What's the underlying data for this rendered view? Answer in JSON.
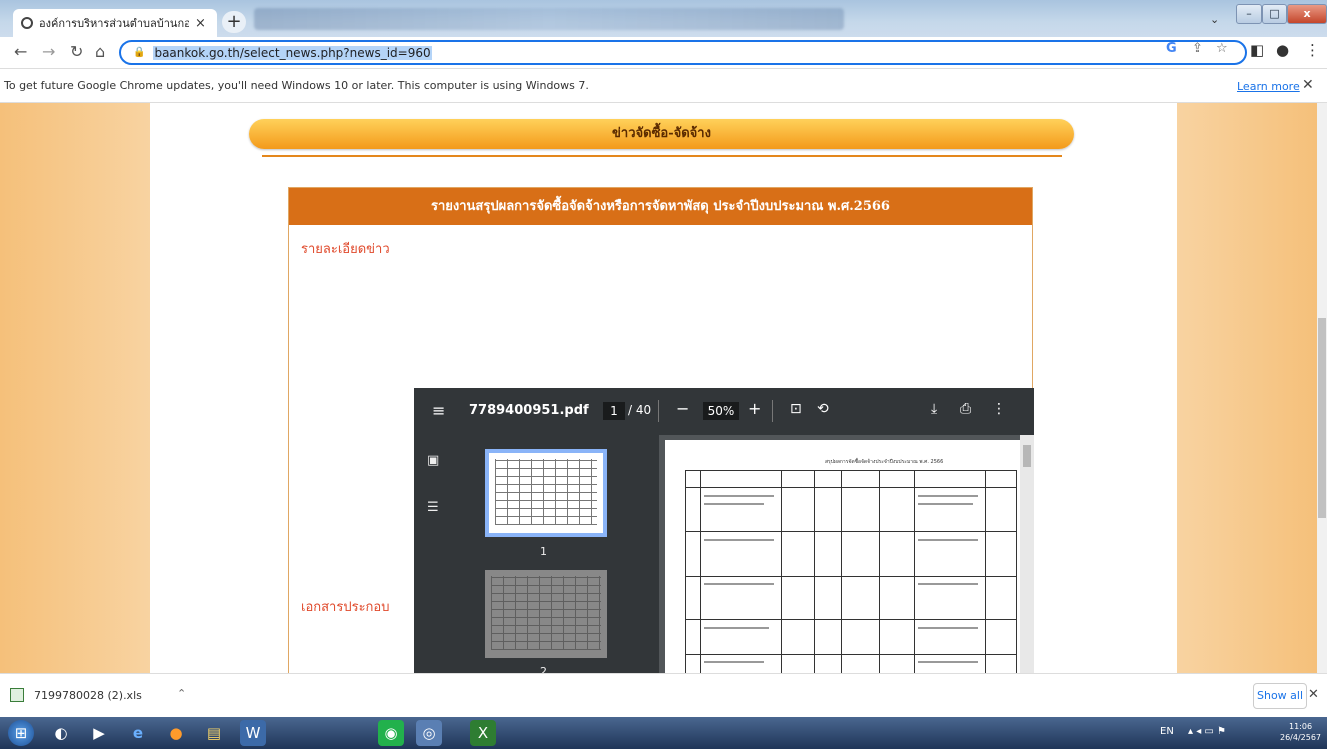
{
  "browser": {
    "tab_title": "องค์การบริหารส่วนตำบลบ้านกอก อำเ",
    "tab_close": "×",
    "new_tab": "+",
    "url": "baankok.go.th/select_news.php?news_id=960",
    "info_message": "To get future Google Chrome updates, you'll need Windows 10 or later. This computer is using Windows 7.",
    "learn_more": "Learn more",
    "close_glyph": "✕"
  },
  "page": {
    "banner_title": "ข่าวจัดซื้อ-จัดจ้าง",
    "panel_title": "รายงานสรุปผลการจัดซื้อจัดจ้างหรือการจัดหาพัสดุ ประจำปีงบประมาณ พ.ศ.2566",
    "detail_label": "รายละเอียดข่าว",
    "attachment_label": "เอกสารประกอบ"
  },
  "pdf_viewer": {
    "filename": "7789400951.pdf",
    "current_page": "1",
    "total_pages": "/ 40",
    "zoom": "50%",
    "thumb_labels": [
      "1",
      "2"
    ],
    "doc_title": "สรุปผลการจัดซื้อจัดจ้างประจำปีงบประมาณ พ.ศ. 2566"
  },
  "downloads": {
    "file_name": "7199780028 (2).xls",
    "show_all": "Show all"
  },
  "taskbar": {
    "language": "EN",
    "time": "11:06",
    "date": "26/4/2567"
  },
  "colors": {
    "banner": "#f39a1b",
    "panel_header": "#d86f17",
    "label_red": "#e04a2c",
    "pdf_toolbar": "#323639"
  }
}
